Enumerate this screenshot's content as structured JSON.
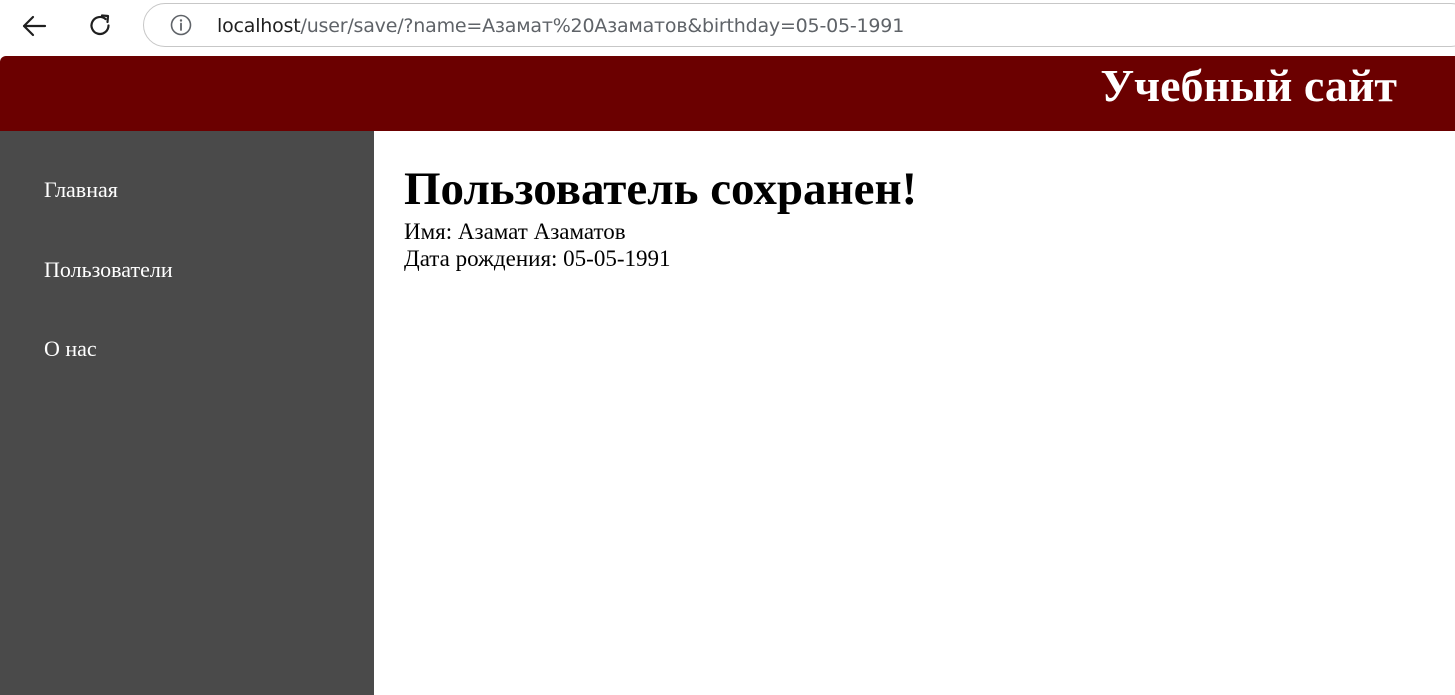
{
  "browser": {
    "url_host": "localhost",
    "url_path": "/user/save/?name=Азамат%20Азаматов&birthday=05-05-1991",
    "icons": {
      "back": "arrow-left-icon",
      "reload": "reload-icon",
      "site_info": "info-icon"
    }
  },
  "header": {
    "title": "Учебный сайт",
    "background_color": "#6b0000"
  },
  "sidebar": {
    "background_color": "#4a4a4a",
    "items": [
      {
        "label": "Главная"
      },
      {
        "label": "Пользователи"
      },
      {
        "label": "О нас"
      }
    ]
  },
  "main": {
    "title": "Пользователь сохранен!",
    "name_line": "Имя: Азамат Азаматов",
    "birthday_line": "Дата рождения: 05-05-1991"
  }
}
